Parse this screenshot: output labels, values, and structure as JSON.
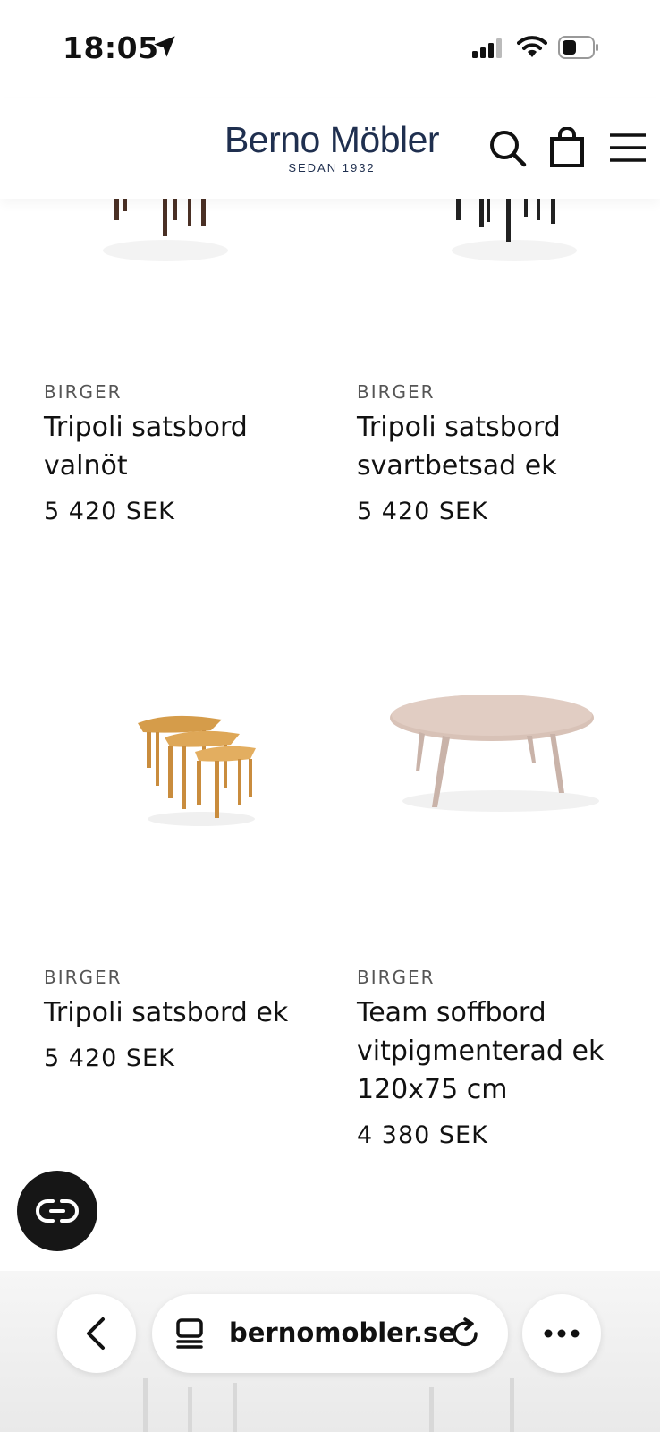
{
  "status": {
    "time": "18:05"
  },
  "header": {
    "logo_main": "Berno Möbler",
    "logo_sub": "SEDAN 1932"
  },
  "products": [
    {
      "brand": "BIRGER",
      "name": "Tripoli satsbord valnöt",
      "price": "5 420 SEK"
    },
    {
      "brand": "BIRGER",
      "name": "Tripoli satsbord svartbetsad ek",
      "price": "5 420 SEK"
    },
    {
      "brand": "BIRGER",
      "name": "Tripoli satsbord ek",
      "price": "5 420 SEK"
    },
    {
      "brand": "BIRGER",
      "name": "Team soffbord vitpigmenterad ek 120x75 cm",
      "price": "4 380 SEK"
    }
  ],
  "browser": {
    "url": "bernomobler.se"
  },
  "colors": {
    "brand": "#1f2f4f",
    "chat_button": "#161616"
  },
  "icons": [
    "location-arrow-icon",
    "cellular-signal-icon",
    "wifi-icon",
    "battery-icon",
    "search-icon",
    "shopping-bag-icon",
    "menu-icon",
    "chat-icon",
    "back-icon",
    "tabs-icon",
    "reload-icon",
    "more-icon"
  ]
}
